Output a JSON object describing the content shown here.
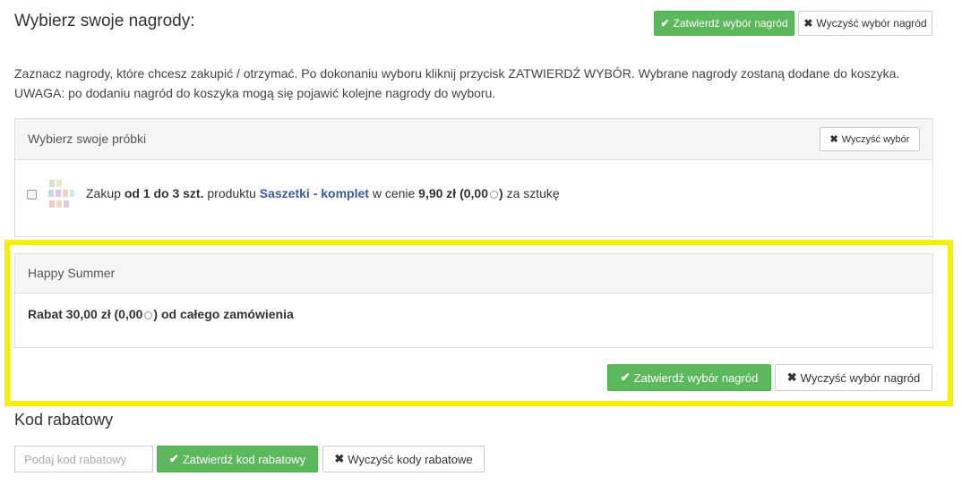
{
  "header": {
    "title": "Wybierz swoje nagrody:",
    "confirm_label": "Zatwierdź wybór nagród",
    "clear_label": "Wyczyść wybór nagród"
  },
  "intro_text": "Zaznacz nagrody, które chcesz zakupić / otrzymać. Po dokonaniu wyboru kliknij przycisk ZATWIERDŹ WYBÓR. Wybrane nagrody zostaną dodane do koszyka. UWAGA: po dodaniu nagród do koszyka mogą się pojawić kolejne nagrody do wyboru.",
  "samples_panel": {
    "title": "Wybierz swoje próbki",
    "clear_label": "Wyczyść wybór",
    "item": {
      "checked": false,
      "prefix": "Zakup",
      "range": "od 1 do 3 szt.",
      "middle": "produktu",
      "product": "Saszetki - komplet",
      "price_prefix": "w cenie",
      "price": "9,90 zł (0,00",
      "price_close": ")",
      "suffix": "za sztukę"
    }
  },
  "promo_panel": {
    "title": "Happy Summer",
    "reward_text": "Rabat 30,00 zł (0,00",
    "reward_close": ") od całego zamówienia"
  },
  "promo_actions": {
    "confirm_label": "Zatwierdź wybór nagród",
    "clear_label": "Wyczyść wybór nagród"
  },
  "discount": {
    "title": "Kod rabatowy",
    "placeholder": "Podaj kod rabatowy",
    "value": "",
    "confirm_label": "Zatwierdź kod rabatowy",
    "clear_label": "Wyczyść kody rabatowe"
  },
  "icons": {
    "check": "check-icon",
    "times": "times-icon",
    "coin": "points-coin-icon",
    "product_thumb": "sachets-thumbnail"
  },
  "colors": {
    "confirm_green": "#5cb85c",
    "highlight_yellow": "#f5ef00",
    "link_blue": "#3b5b9e"
  }
}
